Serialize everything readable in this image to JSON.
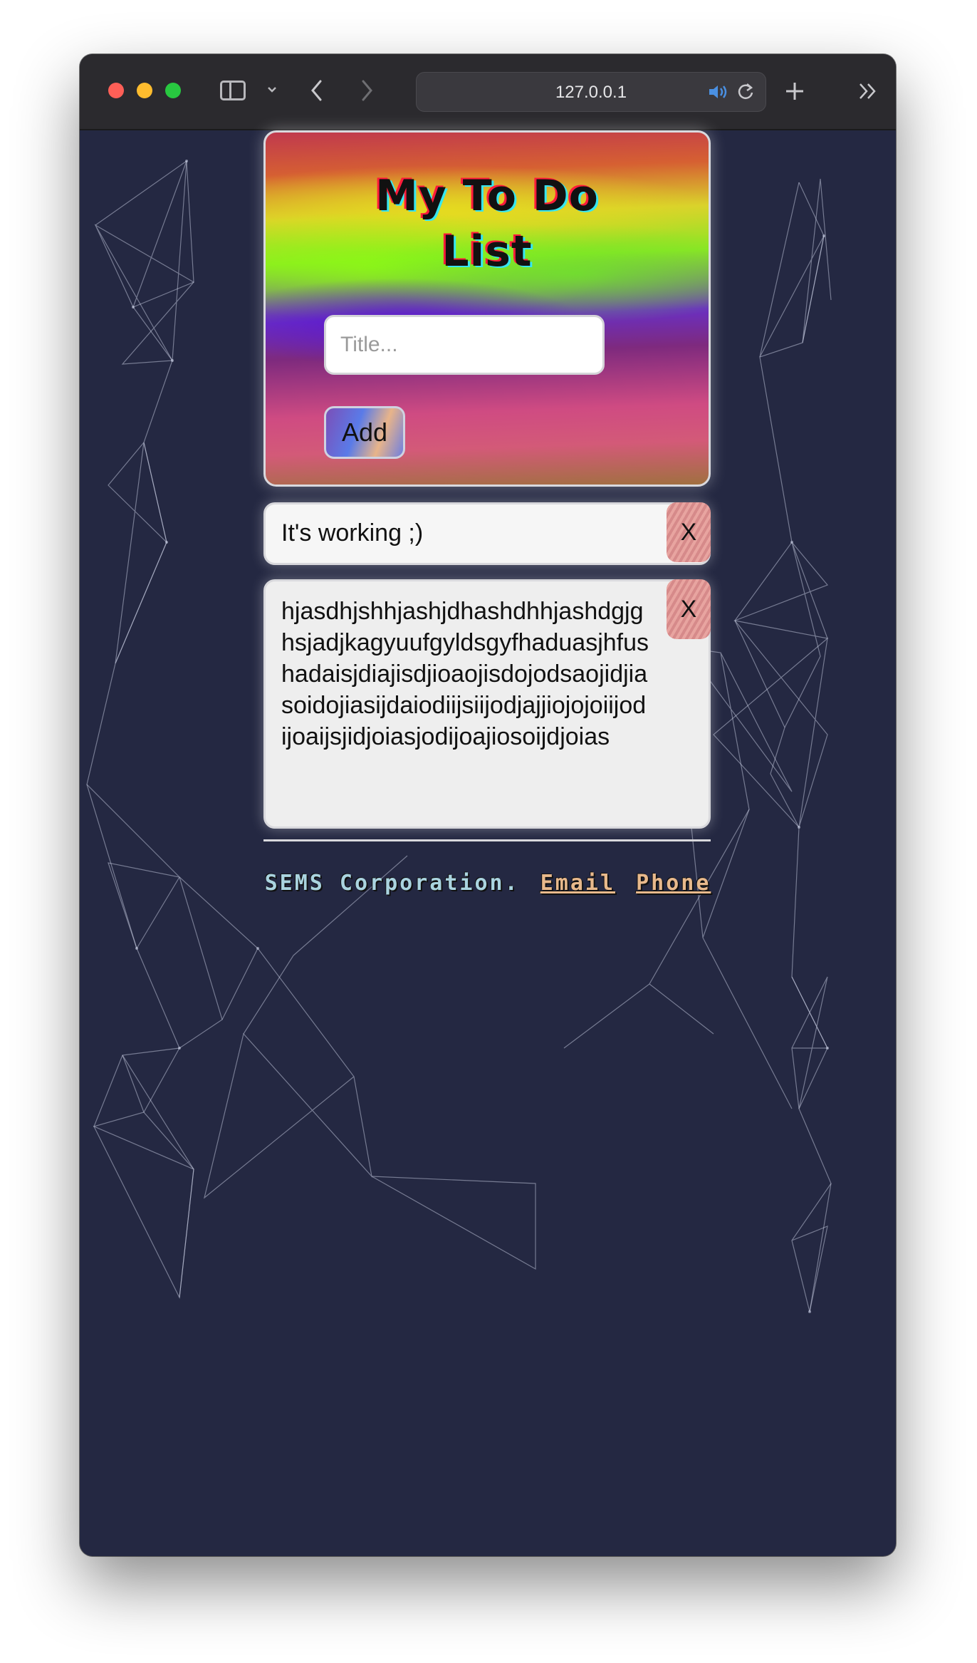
{
  "browser": {
    "url": "127.0.0.1"
  },
  "app": {
    "title": "My To Do List",
    "input_placeholder": "Title...",
    "add_label": "Add"
  },
  "todos": [
    {
      "text": "It's working ;)",
      "delete_label": "X"
    },
    {
      "text": "hjasdhjshhjashjdhashdhhjashdgjghsjadjkagyuufgyldsgyfhaduasjhfushadaisjdiajisdjioaojisdojodsaojidjiasoidojiasijdaiodiijsiijodjajjiojojoiijodijoaijsjidjoiasjodijoajiosoijdjoias",
      "delete_label": "X"
    }
  ],
  "footer": {
    "brand": "SEMS Corporation.",
    "email_label": "Email",
    "phone_label": "Phone"
  },
  "colors": {
    "page_background": "#242842",
    "title_shadow_red": "#ff1b3b",
    "title_shadow_cyan": "#37e6f0",
    "footer_brand": "#aad4e0",
    "footer_links": "#e8b98c"
  },
  "icons": [
    "close-window-dot",
    "minimize-window-dot",
    "zoom-window-dot",
    "sidebar-icon",
    "chevron-down-icon",
    "back-icon",
    "forward-icon",
    "speaker-icon",
    "reload-icon",
    "new-tab-icon",
    "more-tabs-icon"
  ]
}
